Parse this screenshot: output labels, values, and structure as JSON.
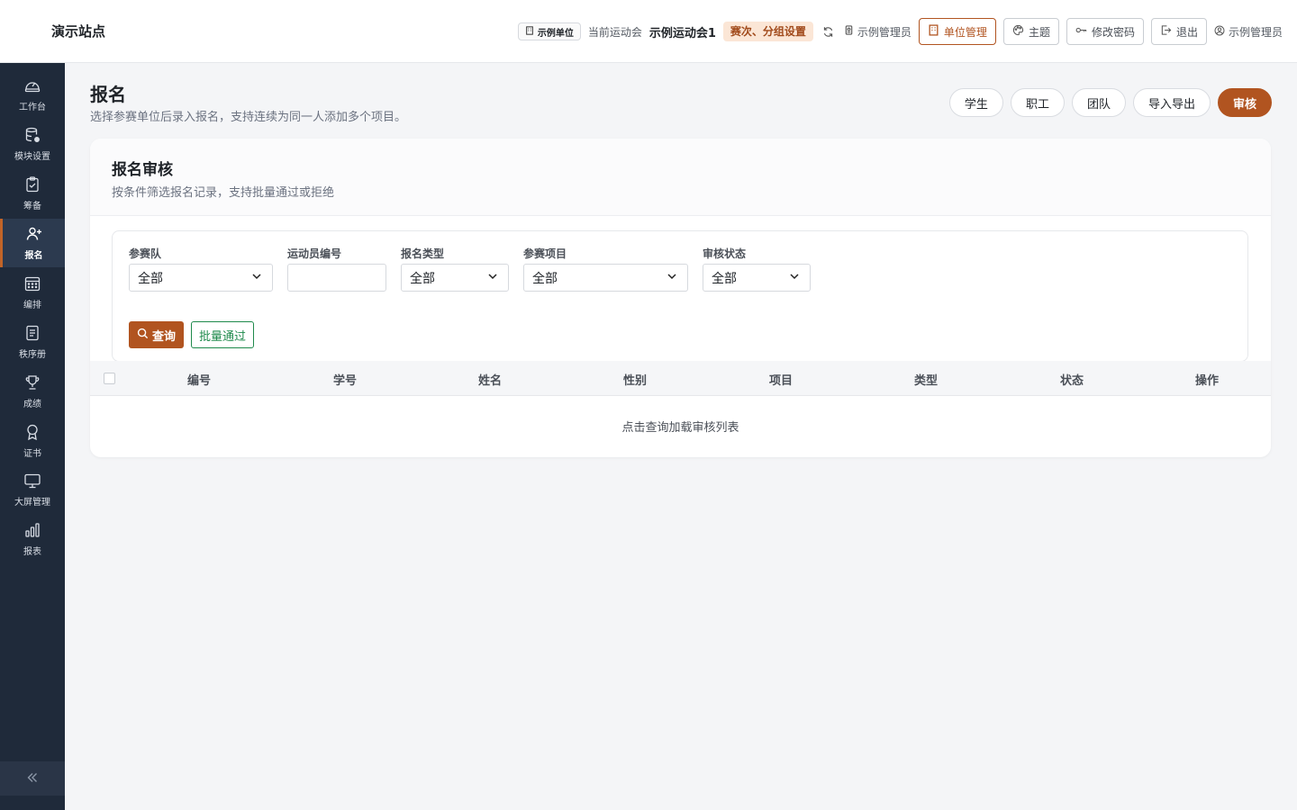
{
  "header": {
    "site_title": "演示站点",
    "unit_chip": "示例单位",
    "current_meet_label": "当前运动会",
    "current_meet_name": "示例运动会1",
    "meet_settings_tag": "赛次、分组设置",
    "admin_inline": "示例管理员",
    "unit_manage_label": "单位管理",
    "theme_label": "主题",
    "change_password_label": "修改密码",
    "logout_label": "退出",
    "user_name": "示例管理员",
    "accent_color": "#b15420"
  },
  "sidebar": {
    "items": [
      {
        "label": "工作台",
        "icon": "dashboard-icon"
      },
      {
        "label": "模块设置",
        "icon": "database-icon"
      },
      {
        "label": "筹备",
        "icon": "clipboard-icon"
      },
      {
        "label": "报名",
        "icon": "user-add-icon"
      },
      {
        "label": "编排",
        "icon": "calendar-icon"
      },
      {
        "label": "秩序册",
        "icon": "document-icon"
      },
      {
        "label": "成绩",
        "icon": "trophy-icon"
      },
      {
        "label": "证书",
        "icon": "award-icon"
      },
      {
        "label": "大屏管理",
        "icon": "monitor-icon"
      },
      {
        "label": "报表",
        "icon": "bar-chart-icon"
      }
    ],
    "active_index": 3,
    "bg_color": "#1f2a3a"
  },
  "page": {
    "title": "报名",
    "subtitle": "选择参赛单位后录入报名，支持连续为同一人添加多个项目。",
    "tabs": [
      {
        "label": "学生",
        "active": false
      },
      {
        "label": "职工",
        "active": false
      },
      {
        "label": "团队",
        "active": false
      },
      {
        "label": "导入导出",
        "active": false
      },
      {
        "label": "审核",
        "active": true
      }
    ]
  },
  "card": {
    "title": "报名审核",
    "subtitle": "按条件筛选报名记录，支持批量通过或拒绝"
  },
  "filters": {
    "team": {
      "label": "参赛队",
      "value": "全部"
    },
    "athlete_no": {
      "label": "运动员编号",
      "value": "",
      "placeholder": ""
    },
    "reg_type": {
      "label": "报名类型",
      "value": "全部"
    },
    "event": {
      "label": "参赛项目",
      "value": "全部"
    },
    "review_status": {
      "label": "审核状态",
      "value": "全部"
    },
    "query_label": "查询",
    "batch_pass_label": "批量通过"
  },
  "table": {
    "columns": [
      "编号",
      "学号",
      "姓名",
      "性别",
      "项目",
      "类型",
      "状态",
      "操作"
    ],
    "empty_text": "点击查询加载审核列表"
  }
}
